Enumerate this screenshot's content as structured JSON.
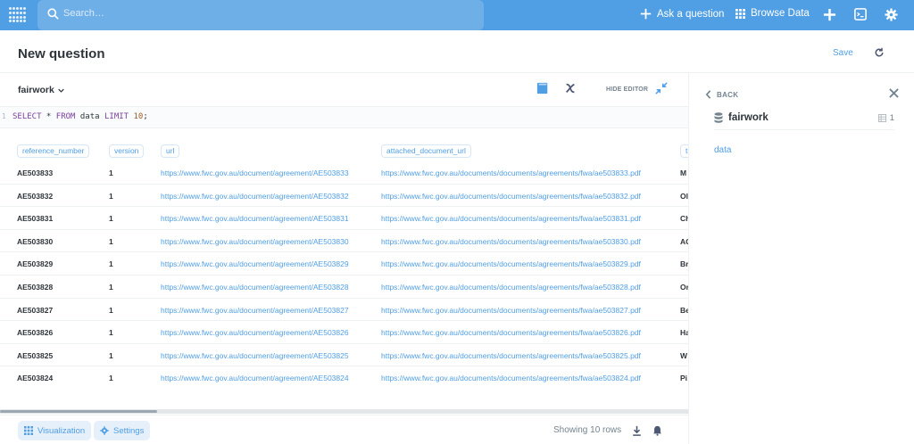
{
  "topnav": {
    "search_placeholder": "Search…",
    "ask_question": "Ask a question",
    "browse_data": "Browse Data"
  },
  "question": {
    "title": "New question",
    "save": "Save"
  },
  "editor": {
    "database": "fairwork",
    "hide_editor": "HIDE EDITOR",
    "line_number": "1",
    "sql_keyword1": "SELECT",
    "sql_star": " * ",
    "sql_keyword2": "FROM",
    "sql_table": " data ",
    "sql_keyword3": "LIMIT",
    "sql_limit": " 10",
    "sql_end": ";"
  },
  "table": {
    "columns": [
      "reference_number",
      "version",
      "url",
      "attached_document_url",
      "t"
    ],
    "rows": [
      {
        "ref": "AE503833",
        "ver": "1",
        "url": "https://www.fwc.gov.au/document/agreement/AE503833",
        "doc": "https://www.fwc.gov.au/documents/documents/agreements/fwa/ae503833.pdf",
        "t": "M"
      },
      {
        "ref": "AE503832",
        "ver": "1",
        "url": "https://www.fwc.gov.au/document/agreement/AE503832",
        "doc": "https://www.fwc.gov.au/documents/documents/agreements/fwa/ae503832.pdf",
        "t": "Ol"
      },
      {
        "ref": "AE503831",
        "ver": "1",
        "url": "https://www.fwc.gov.au/document/agreement/AE503831",
        "doc": "https://www.fwc.gov.au/documents/documents/agreements/fwa/ae503831.pdf",
        "t": "Ch"
      },
      {
        "ref": "AE503830",
        "ver": "1",
        "url": "https://www.fwc.gov.au/document/agreement/AE503830",
        "doc": "https://www.fwc.gov.au/documents/documents/agreements/fwa/ae503830.pdf",
        "t": "AC"
      },
      {
        "ref": "AE503829",
        "ver": "1",
        "url": "https://www.fwc.gov.au/document/agreement/AE503829",
        "doc": "https://www.fwc.gov.au/documents/documents/agreements/fwa/ae503829.pdf",
        "t": "Br"
      },
      {
        "ref": "AE503828",
        "ver": "1",
        "url": "https://www.fwc.gov.au/document/agreement/AE503828",
        "doc": "https://www.fwc.gov.au/documents/documents/agreements/fwa/ae503828.pdf",
        "t": "Or"
      },
      {
        "ref": "AE503827",
        "ver": "1",
        "url": "https://www.fwc.gov.au/document/agreement/AE503827",
        "doc": "https://www.fwc.gov.au/documents/documents/agreements/fwa/ae503827.pdf",
        "t": "Be"
      },
      {
        "ref": "AE503826",
        "ver": "1",
        "url": "https://www.fwc.gov.au/document/agreement/AE503826",
        "doc": "https://www.fwc.gov.au/documents/documents/agreements/fwa/ae503826.pdf",
        "t": "Ha"
      },
      {
        "ref": "AE503825",
        "ver": "1",
        "url": "https://www.fwc.gov.au/document/agreement/AE503825",
        "doc": "https://www.fwc.gov.au/documents/documents/agreements/fwa/ae503825.pdf",
        "t": "W"
      },
      {
        "ref": "AE503824",
        "ver": "1",
        "url": "https://www.fwc.gov.au/document/agreement/AE503824",
        "doc": "https://www.fwc.gov.au/documents/documents/agreements/fwa/ae503824.pdf",
        "t": "Pi"
      }
    ]
  },
  "footer": {
    "visualization": "Visualization",
    "settings": "Settings",
    "showing": "Showing 10 rows"
  },
  "sidebar": {
    "back": "BACK",
    "database": "fairwork",
    "table_count": "1",
    "table_name": "data"
  },
  "colors": {
    "brand": "#509ee3",
    "text_dark": "#2e353b",
    "text_muted": "#74838f"
  }
}
